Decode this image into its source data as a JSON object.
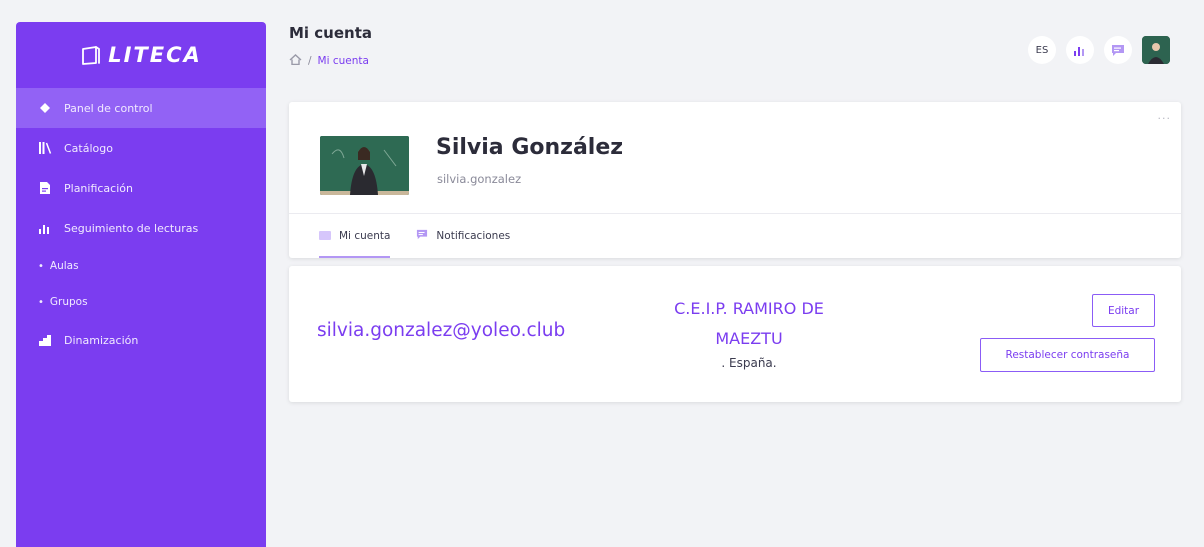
{
  "brand": {
    "name": "LITECA"
  },
  "sidebar": {
    "items": [
      {
        "label": "Panel de control",
        "icon": "diamond-icon",
        "active": true
      },
      {
        "label": "Catálogo",
        "icon": "books-icon"
      },
      {
        "label": "Planificación",
        "icon": "document-icon"
      },
      {
        "label": "Seguimiento de lecturas",
        "icon": "bar-chart-icon"
      }
    ],
    "sub_items": [
      {
        "label": "Aulas"
      },
      {
        "label": "Grupos"
      }
    ],
    "last_item": {
      "label": "Dinamización",
      "icon": "signal-icon"
    }
  },
  "header": {
    "title": "Mi cuenta",
    "breadcrumb": {
      "separator": "/",
      "current": "Mi cuenta"
    },
    "language": "ES"
  },
  "profile": {
    "name": "Silvia González",
    "username": "silvia.gonzalez",
    "more": "···"
  },
  "tabs": [
    {
      "label": "Mi cuenta",
      "active": true
    },
    {
      "label": "Notificaciones"
    }
  ],
  "details": {
    "email": "silvia.gonzalez@yoleo.club",
    "school_line1": "C.E.I.P. RAMIRO DE",
    "school_line2": "MAEZTU",
    "country": ". España.",
    "edit_label": "Editar",
    "reset_label": "Restablecer contraseña"
  },
  "colors": {
    "accent": "#7b3df0",
    "sidebar_active": "#9262f5",
    "background": "#f2f3f6"
  }
}
